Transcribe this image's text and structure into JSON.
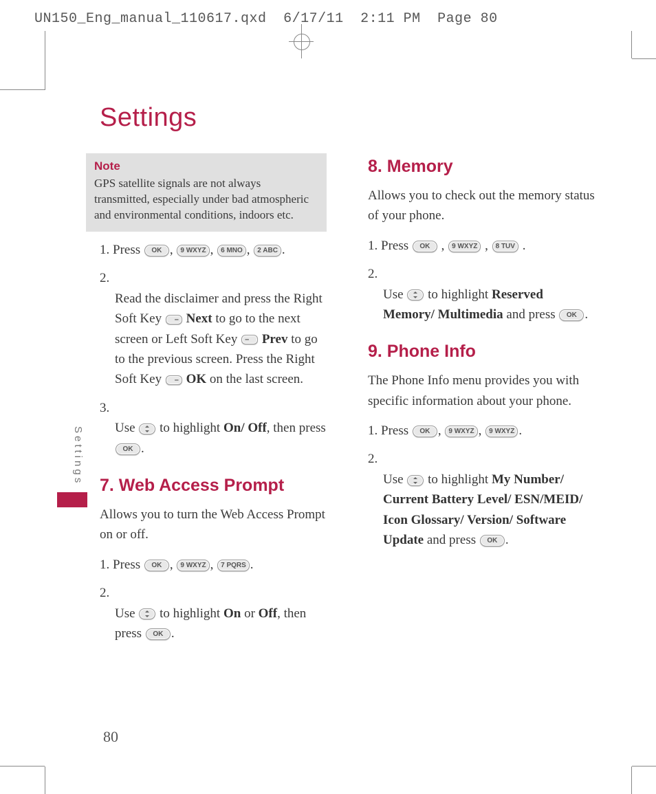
{
  "slug": {
    "file": "UN150_Eng_manual_110617.qxd",
    "date": "6/17/11",
    "time": "2:11 PM",
    "page_label": "Page 80"
  },
  "title": "Settings",
  "side_tab": "Settings",
  "page_number": "80",
  "keys": {
    "ok": "OK",
    "k9": "9 WXYZ",
    "k8": "8 TUV",
    "k7": "7 PQRS",
    "k6": "6 MNO",
    "k2": "2 ABC"
  },
  "left": {
    "note_title": "Note",
    "note_body": "GPS satellite signals are not always transmitted, especially under bad atmospheric and environmental conditions, indoors etc.",
    "s1": {
      "num": "1.",
      "a": "Press ",
      "b": ", ",
      "c": ", ",
      "d": ", ",
      "e": "."
    },
    "s2": {
      "num": "2.",
      "a": "Read the disclaimer and press the Right Soft Key ",
      "next": "Next",
      "b": " to go to the next screen or Left Soft Key ",
      "prev": "Prev",
      "c": " to go to the previous screen. Press the Right Soft Key ",
      "ok": "OK",
      "d": " on the last screen."
    },
    "s3": {
      "num": "3.",
      "a": "Use ",
      "b": " to highlight ",
      "onoff": "On/ Off",
      "c": ", then press ",
      "d": "."
    },
    "h7": "7. Web Access Prompt",
    "p7": "Allows you to turn the Web Access Prompt on or off.",
    "s7_1": {
      "num": "1.",
      "a": "Press ",
      "b": ", ",
      "c": ", ",
      "d": "."
    },
    "s7_2": {
      "num": "2.",
      "a": "Use ",
      "b": " to highlight ",
      "on": "On",
      "c": " or ",
      "off": "Off",
      "d": ", then press ",
      "e": "."
    }
  },
  "right": {
    "h8": "8. Memory",
    "p8": "Allows you to check out the memory status of your phone.",
    "s8_1": {
      "num": "1.",
      "a": "Press ",
      "b": " , ",
      "c": " , ",
      "d": " ."
    },
    "s8_2": {
      "num": "2.",
      "a": "Use ",
      "b": " to highlight ",
      "opt": "Reserved Memory/ Multimedia",
      "c": " and press ",
      "d": "."
    },
    "h9": "9. Phone Info",
    "p9": "The Phone Info menu provides you with specific information about your phone.",
    "s9_1": {
      "num": "1.",
      "a": "Press ",
      "b": ", ",
      "c": ", ",
      "d": "."
    },
    "s9_2": {
      "num": "2.",
      "a": "Use ",
      "b": " to highlight ",
      "opt": "My Number/ Current Battery Level/ ESN/MEID/ Icon Glossary/ Version/ Software Update",
      "c": " and press ",
      "d": "."
    }
  }
}
